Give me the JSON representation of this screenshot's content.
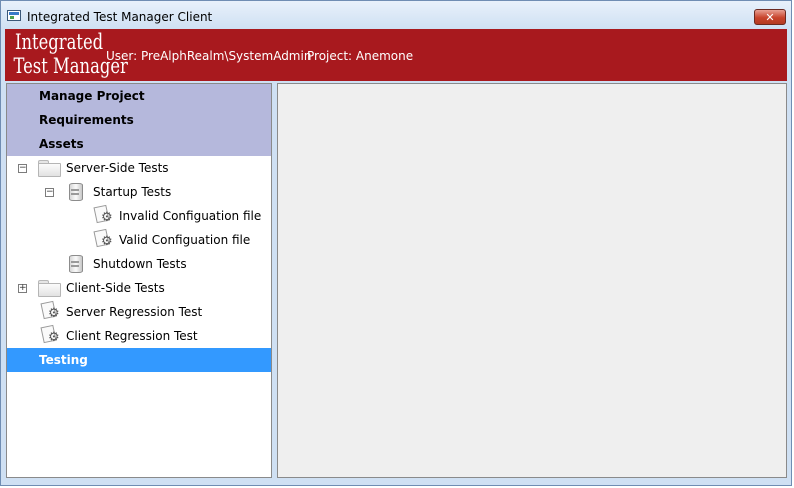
{
  "window": {
    "title": "Integrated Test Manager Client",
    "close_glyph": "✕"
  },
  "banner": {
    "logo_line1": "Integrated",
    "logo_line2": "Test Manager",
    "user": "User: PreAlphRealm\\SystemAdmin",
    "project": "Project: Anemone",
    "background": "#a8191e"
  },
  "nav": {
    "manage_project": "Manage Project",
    "requirements": "Requirements",
    "assets": "Assets",
    "testing": "Testing",
    "header_color": "#b5b8dc",
    "selected_color": "#3399ff"
  },
  "tree": [
    {
      "label": "Server-Side Tests",
      "icon": "folder-icon",
      "expander": "⊟"
    },
    {
      "label": "Startup Tests",
      "icon": "suite-icon",
      "expander": "⊟"
    },
    {
      "label": "Invalid Configuation file",
      "icon": "test-icon"
    },
    {
      "label": "Valid Configuation file",
      "icon": "test-icon"
    },
    {
      "label": "Shutdown Tests",
      "icon": "suite-icon"
    },
    {
      "label": "Client-Side Tests",
      "icon": "folder-icon",
      "expander": "⊞"
    },
    {
      "label": "Server Regression Test",
      "icon": "test-icon"
    },
    {
      "label": "Client Regression Test",
      "icon": "test-icon"
    }
  ]
}
